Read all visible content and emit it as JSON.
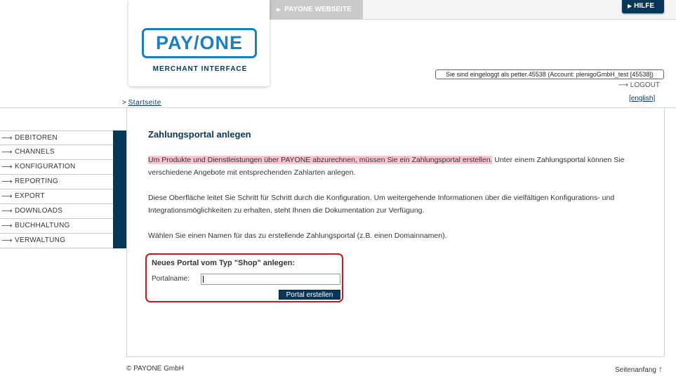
{
  "header": {
    "payone_website_label": "PAYONE WEBSEITE",
    "help_label": "HILFE",
    "logo_wordmark": "PAY/ONE",
    "logo_subtitle": "MERCHANT INTERFACE",
    "login_info": "Sie sind eingeloggt als petter.45538 (Account: plenigoGmbH_test [45538])",
    "logout_label": "LOGOUT",
    "language_link": "[english]"
  },
  "breadcrumb": {
    "prefix": ">",
    "home_link": "Startseite"
  },
  "sidebar": {
    "items": [
      {
        "label": "DEBITOREN"
      },
      {
        "label": "CHANNELS"
      },
      {
        "label": "KONFIGURATION"
      },
      {
        "label": "REPORTING"
      },
      {
        "label": "EXPORT"
      },
      {
        "label": "DOWNLOADS"
      },
      {
        "label": "BUCHHALTUNG"
      },
      {
        "label": "VERWALTUNG"
      }
    ]
  },
  "main": {
    "title": "Zahlungsportal anlegen",
    "intro_highlight": "Um Produkte und Dienstleistungen über PAYONE abzurechnen, müssen Sie ein Zahlungsportal erstellen.",
    "intro_rest": " Unter einem Zahlungsportal können Sie verschiedene Angebote mit entsprechenden Zahlarten anlegen.",
    "para2": "Diese Oberfläche leitet Sie Schritt für Schritt durch die Konfiguration. Um weitergehende Informationen über die vielfältigen Konfigurations- und Integrationsmöglichkeiten zu erhalten, steht Ihnen die Dokumentation zur Verfügung.",
    "para3": "Wählen Sie einen Namen für das zu erstellende Zahlungsportal (z.B. einen Domainnamen).",
    "form": {
      "title": "Neues Portal vom Typ \"Shop\" anlegen:",
      "portalname_label": "Portalname:",
      "portalname_value": "",
      "submit_label": "Portal erstellen"
    }
  },
  "footer": {
    "copyright": "© PAYONE GmbH",
    "back_to_top": "Seitenanfang"
  },
  "colors": {
    "brand_navy": "#063759",
    "brand_blue": "#1a7fc1",
    "highlight_pink": "#f9c4cf",
    "callout_red": "#d8151a"
  }
}
